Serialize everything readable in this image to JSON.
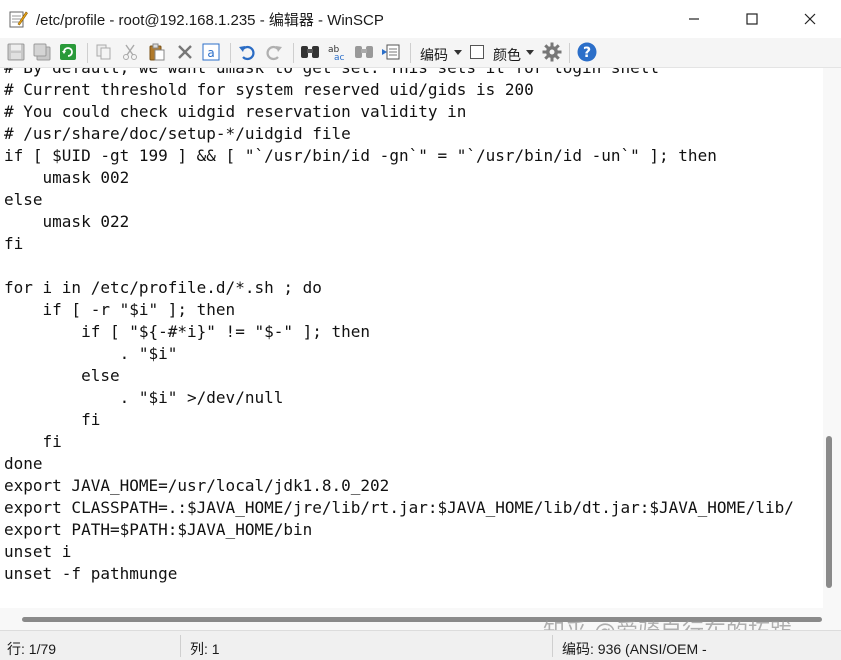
{
  "window": {
    "title": "/etc/profile - root@192.168.1.235 - 编辑器 - WinSCP"
  },
  "toolbar": {
    "icons": [
      "save-icon",
      "save-all-icon",
      "reload-icon",
      "copy-icon",
      "cut-icon",
      "paste-icon",
      "delete-icon",
      "select-all-icon",
      "undo-icon",
      "redo-icon",
      "find-icon",
      "replace-icon",
      "find-next-icon",
      "goto-line-icon",
      "settings-icon",
      "help-icon"
    ],
    "encoding_label": "编码",
    "color_label": "颜色",
    "colors": {
      "undo": "#2b6cc4",
      "help": "#2c6fc9",
      "reload": "#2a9a3a"
    }
  },
  "editor": {
    "lines": [
      "# By default, we want umask to get set. This sets it for login shell",
      "# Current threshold for system reserved uid/gids is 200",
      "# You could check uidgid reservation validity in",
      "# /usr/share/doc/setup-*/uidgid file",
      "if [ $UID -gt 199 ] && [ \"`/usr/bin/id -gn`\" = \"`/usr/bin/id -un`\" ]; then",
      "    umask 002",
      "else",
      "    umask 022",
      "fi",
      "",
      "for i in /etc/profile.d/*.sh ; do",
      "    if [ -r \"$i\" ]; then",
      "        if [ \"${-#*i}\" != \"$-\" ]; then",
      "            . \"$i\"",
      "        else",
      "            . \"$i\" >/dev/null",
      "        fi",
      "    fi",
      "done",
      "export JAVA_HOME=/usr/local/jdk1.8.0_202",
      "export CLASSPATH=.:$JAVA_HOME/jre/lib/rt.jar:$JAVA_HOME/lib/dt.jar:$JAVA_HOME/lib/",
      "export PATH=$PATH:$JAVA_HOME/bin",
      "unset i",
      "unset -f pathmunge"
    ]
  },
  "watermark": "知乎 @爱骑自行车的拓跋",
  "statusbar": {
    "line": "行: 1/79",
    "column": "列: 1",
    "encoding": "编码: 936 (ANSI/OEM -"
  }
}
